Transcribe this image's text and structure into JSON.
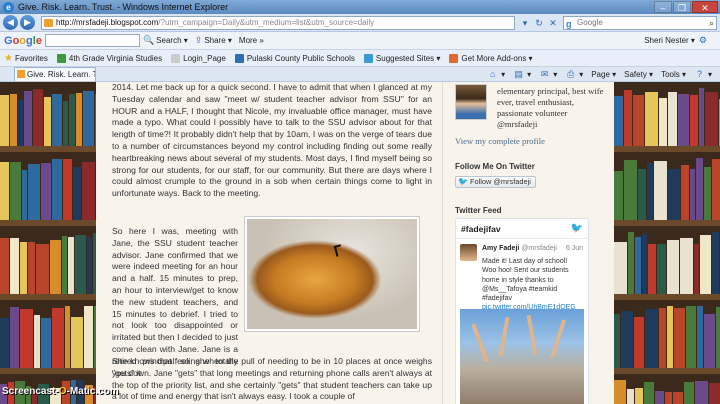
{
  "window": {
    "title": "Give. Risk. Learn. Trust. - Windows Internet Explorer",
    "buttons": [
      "–",
      "❐",
      "✕"
    ]
  },
  "address": {
    "host": "http://mrsfadeji.blogspot.com",
    "path": "/?utm_campaign=Daily&utm_medium=list&utm_source=daily",
    "search_placeholder": "Google"
  },
  "google_toolbar": {
    "logo": [
      "G",
      "o",
      "o",
      "g",
      "l",
      "e"
    ],
    "buttons": [
      {
        "icon": "🔍",
        "label": "Search ▾"
      },
      {
        "icon": "⇪",
        "label": "Share ▾"
      },
      {
        "icon": "",
        "label": "More »"
      }
    ],
    "user": "Sheri Nester ▾"
  },
  "favorites": {
    "label": "Favorites",
    "items": [
      {
        "label": "4th Grade Virginia Studies",
        "color": "#3a9b3a"
      },
      {
        "label": "Login_Page",
        "color": "#cccccc"
      },
      {
        "label": "Pulaski County Public Schools",
        "color": "#2f6cb5"
      },
      {
        "label": "Suggested Sites ▾",
        "color": "#3a9bd0"
      },
      {
        "label": "Get More Add-ons ▾",
        "color": "#e06a30"
      }
    ]
  },
  "tab": {
    "label": "Give. Risk. Learn. Trust."
  },
  "commands": [
    {
      "icon": "⌂",
      "label": "▾"
    },
    {
      "icon": "▤",
      "label": "▾"
    },
    {
      "icon": "✉",
      "label": "▾"
    },
    {
      "icon": "⎙",
      "label": "▾"
    },
    {
      "icon": "",
      "label": "Page ▾"
    },
    {
      "icon": "",
      "label": "Safety ▾"
    },
    {
      "icon": "",
      "label": "Tools ▾"
    },
    {
      "icon": "?",
      "label": "▾"
    }
  ],
  "post": {
    "para1": "2014. Let me back up for a quick second. I have to admit that when I glanced at my Tuesday calendar and saw \"meet w/ student teacher advisor from SSU\" for an HOUR and a HALF, I thought that Nicole, my invaluable office manager, must have made a typo. What could I possibly have to talk to the SSU advisor about for that length of time?! It probably didn't help that by 10am, I was on the verge of tears due to a number of circumstances beyond my control including finding out some really heartbreaking news about several of my students. Most days, I find myself being so strong for our students, for our staff, for our community. But there are days where I could almost crumple to the ground in a sob when certain things come to light in unfortunate ways. Back to the meeting.",
    "wrap": "So here I was, meeting with Jane, the SSU student teacher advisor. Jane confirmed that we were indeed meeting for an hour and a half. 15 minutes to prep, an hour to interview/get to know the new student teachers, and 15 minutes to debrief. I tried to not look too disappointed or irritated but then I decided to just come clean with Jane. Jane is a retired principal so she totally \"gets\" it.",
    "after": "She knows that feeling when the pull of needing to be in 10 places at once weighs you down. Jane \"gets\" that long meetings and returning phone calls aren't always at the top of the priority list, and she certainly \"gets\" that student teachers can take up a lot of time and energy that isn't always easy. I took a couple of"
  },
  "sidebar": {
    "bio": "elementary principal, best wife ever, travel enthusiast, passionate volunteer @mrsfadeji",
    "profile_link": "View my complete profile",
    "follow_heading": "Follow Me On Twitter",
    "follow_button": "Follow @mrsfadeji",
    "feed_heading": "Twitter Feed",
    "widget": {
      "hashtag": "#fadejifav",
      "tweet": {
        "name": "Amy Fadeji",
        "handle": "@mrsfadeji",
        "date": "6 Jun",
        "text": "Made it! Last day of school! Woo hoo! Sent our students home in style thanks to @Ms__Tafoya #teamkid #fadejifav",
        "link": "pic.twitter.com/UhBmE1dQEG"
      }
    }
  },
  "watermark": {
    "pre": "Screencast-",
    "o": "O",
    "post": "-Matic.com"
  }
}
